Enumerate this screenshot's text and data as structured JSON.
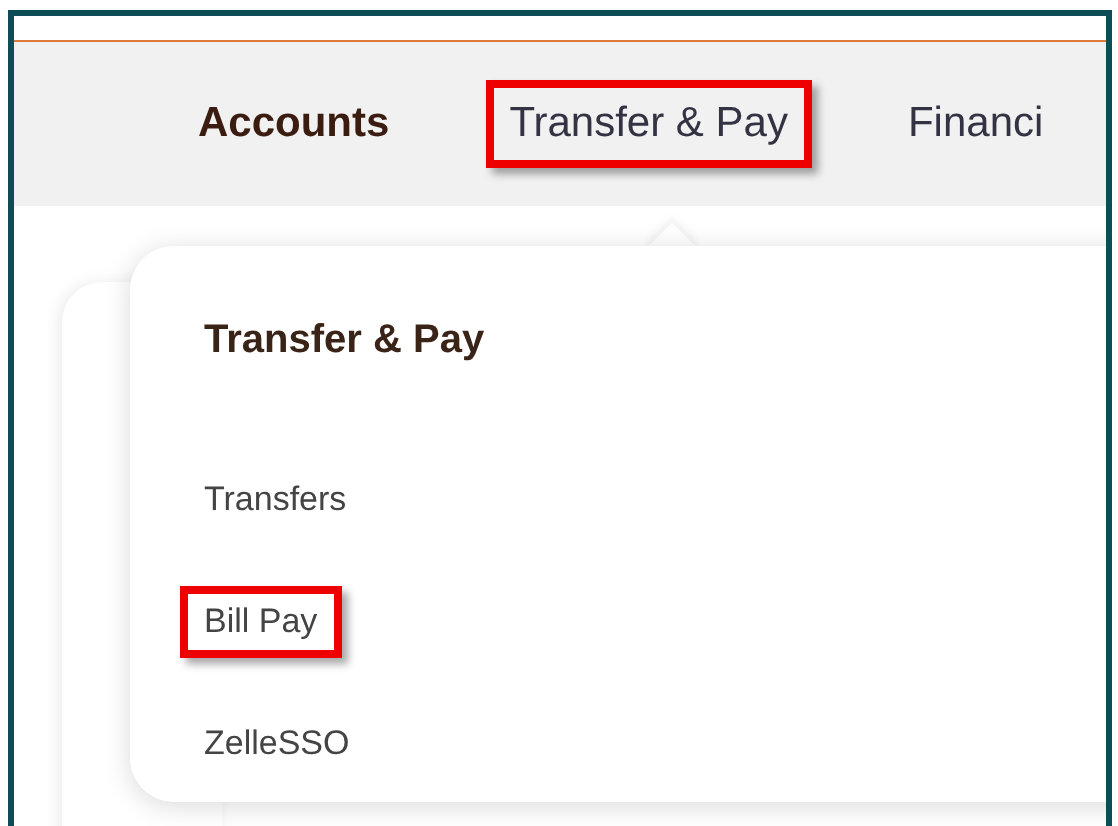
{
  "nav": {
    "items": [
      {
        "label": "Accounts",
        "selected": true,
        "highlighted": false
      },
      {
        "label": "Transfer & Pay",
        "selected": false,
        "highlighted": true
      },
      {
        "label": "Financi",
        "selected": false,
        "highlighted": false
      }
    ]
  },
  "dropdown": {
    "title": "Transfer & Pay",
    "items": [
      {
        "label": "Transfers",
        "highlighted": false
      },
      {
        "label": "Bill Pay",
        "highlighted": true
      },
      {
        "label": "ZelleSSO",
        "highlighted": false
      }
    ]
  }
}
